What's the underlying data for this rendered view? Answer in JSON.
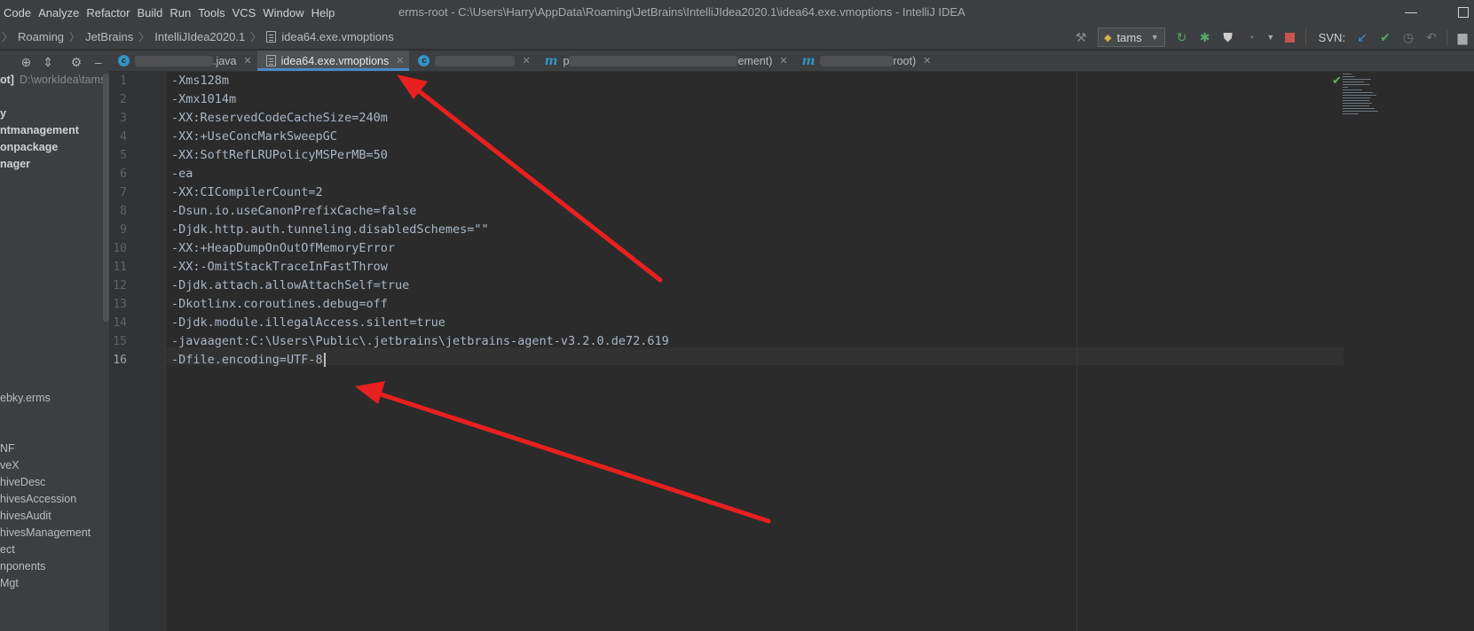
{
  "menu": [
    "Code",
    "Analyze",
    "Refactor",
    "Build",
    "Run",
    "Tools",
    "VCS",
    "Window",
    "Help"
  ],
  "window_title": "erms-root - C:\\Users\\Harry\\AppData\\Roaming\\JetBrains\\IntelliJIdea2020.1\\idea64.exe.vmoptions - IntelliJ IDEA",
  "breadcrumb": [
    "Roaming",
    "JetBrains",
    "IntelliJIdea2020.1",
    "idea64.exe.vmoptions"
  ],
  "toolbar": {
    "run_config": "tams",
    "svn_label": "SVN:"
  },
  "project": {
    "root_name": "ot]",
    "root_path": "D:\\workIdea\\tams-",
    "items": [
      "y",
      "ntmanagement",
      "onpackage",
      "nager",
      "ebky.erms",
      "NF",
      "veX",
      "hiveDesc",
      "hivesAccession",
      "hivesAudit",
      "hivesManagement",
      "ect",
      "nponents",
      "Mgt"
    ]
  },
  "tabs": [
    {
      "label": ".java",
      "kind": "class"
    },
    {
      "label": "idea64.exe.vmoptions",
      "kind": "file",
      "active": true
    },
    {
      "label": "",
      "kind": "class"
    },
    {
      "label": "p",
      "suffix": "ement)",
      "kind": "m"
    },
    {
      "label": "",
      "suffix": "root)",
      "kind": "m"
    }
  ],
  "editor": {
    "lines": [
      "-Xms128m",
      "-Xmx1014m",
      "-XX:ReservedCodeCacheSize=240m",
      "-XX:+UseConcMarkSweepGC",
      "-XX:SoftRefLRUPolicyMSPerMB=50",
      "-ea",
      "-XX:CICompilerCount=2",
      "-Dsun.io.useCanonPrefixCache=false",
      "-Djdk.http.auth.tunneling.disabledSchemes=\"\"",
      "-XX:+HeapDumpOnOutOfMemoryError",
      "-XX:-OmitStackTraceInFastThrow",
      "-Djdk.attach.allowAttachSelf=true",
      "-Dkotlinx.coroutines.debug=off",
      "-Djdk.module.illegalAccess.silent=true",
      "-javaagent:C:\\Users\\Public\\.jetbrains\\jetbrains-agent-v3.2.0.de72.619",
      "-Dfile.encoding=UTF-8"
    ],
    "line_numbers": [
      "1",
      "2",
      "3",
      "4",
      "5",
      "6",
      "7",
      "8",
      "9",
      "10",
      "11",
      "12",
      "13",
      "14",
      "15",
      "16"
    ]
  },
  "colors": {
    "annotation_arrow": "#e8201f",
    "active_tab_underline": "#4a88c7"
  }
}
